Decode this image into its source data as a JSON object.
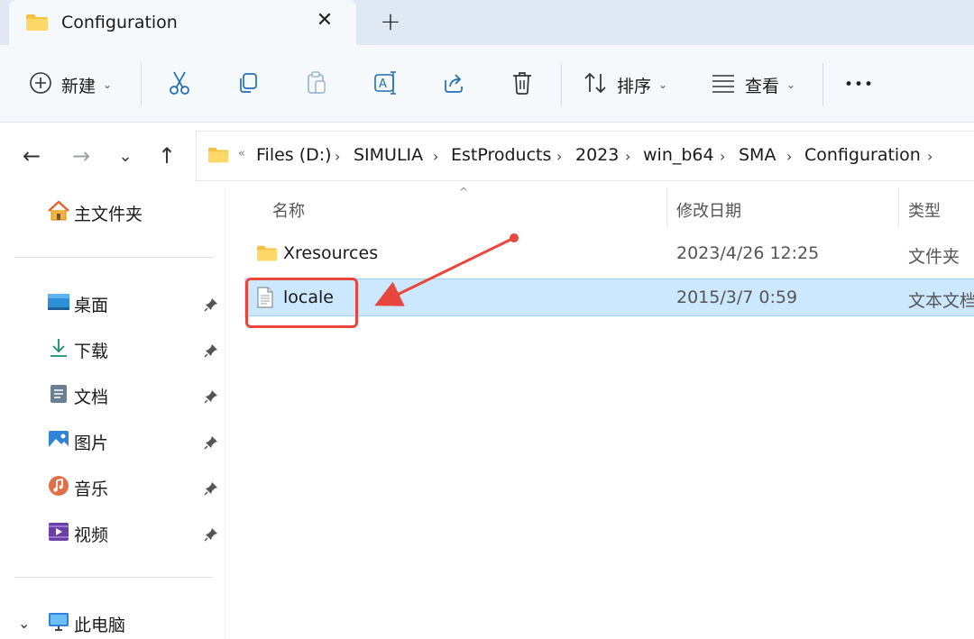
{
  "tab": {
    "title": "Configuration",
    "close_glyph": "✕",
    "new_tab_glyph": "+"
  },
  "toolbar": {
    "new_label": "新建",
    "sort_label": "排序",
    "view_label": "查看",
    "more_glyph": "•••",
    "caret": "⌄",
    "icons": [
      "plus-circle-icon",
      "cut-icon",
      "copy-icon",
      "paste-icon",
      "rename-icon",
      "share-icon",
      "delete-icon",
      "sort-icon",
      "view-icon",
      "more-icon"
    ]
  },
  "nav": {
    "back": "←",
    "forward": "→",
    "recent": "⌄",
    "up": "↑",
    "overflow": "«",
    "breadcrumbs": [
      "Files (D:)",
      "SIMULIA",
      "EstProducts",
      "2023",
      "win_b64",
      "SMA",
      "Configuration"
    ],
    "sep": "›"
  },
  "sidebar": {
    "home": "主文件夹",
    "quick": [
      {
        "label": "桌面",
        "icon": "desktop-icon"
      },
      {
        "label": "下载",
        "icon": "download-icon"
      },
      {
        "label": "文档",
        "icon": "documents-icon"
      },
      {
        "label": "图片",
        "icon": "pictures-icon"
      },
      {
        "label": "音乐",
        "icon": "music-icon"
      },
      {
        "label": "视频",
        "icon": "videos-icon"
      }
    ],
    "this_pc": "此电脑",
    "expand": "⌄"
  },
  "columns": {
    "name": "名称",
    "modified": "修改日期",
    "type": "类型",
    "sort_caret": "^"
  },
  "files": [
    {
      "name": "Xresources",
      "modified": "2023/4/26 12:25",
      "type": "文件夹",
      "icon": "folder-icon",
      "selected": false
    },
    {
      "name": "locale",
      "modified": "2015/3/7 0:59",
      "type": "文本文档",
      "icon": "text-file-icon",
      "selected": true
    }
  ],
  "colors": {
    "accent": "#0067c0",
    "selection": "#cce8ff",
    "annotation": "#e8453c",
    "folder": "#f5c342"
  }
}
